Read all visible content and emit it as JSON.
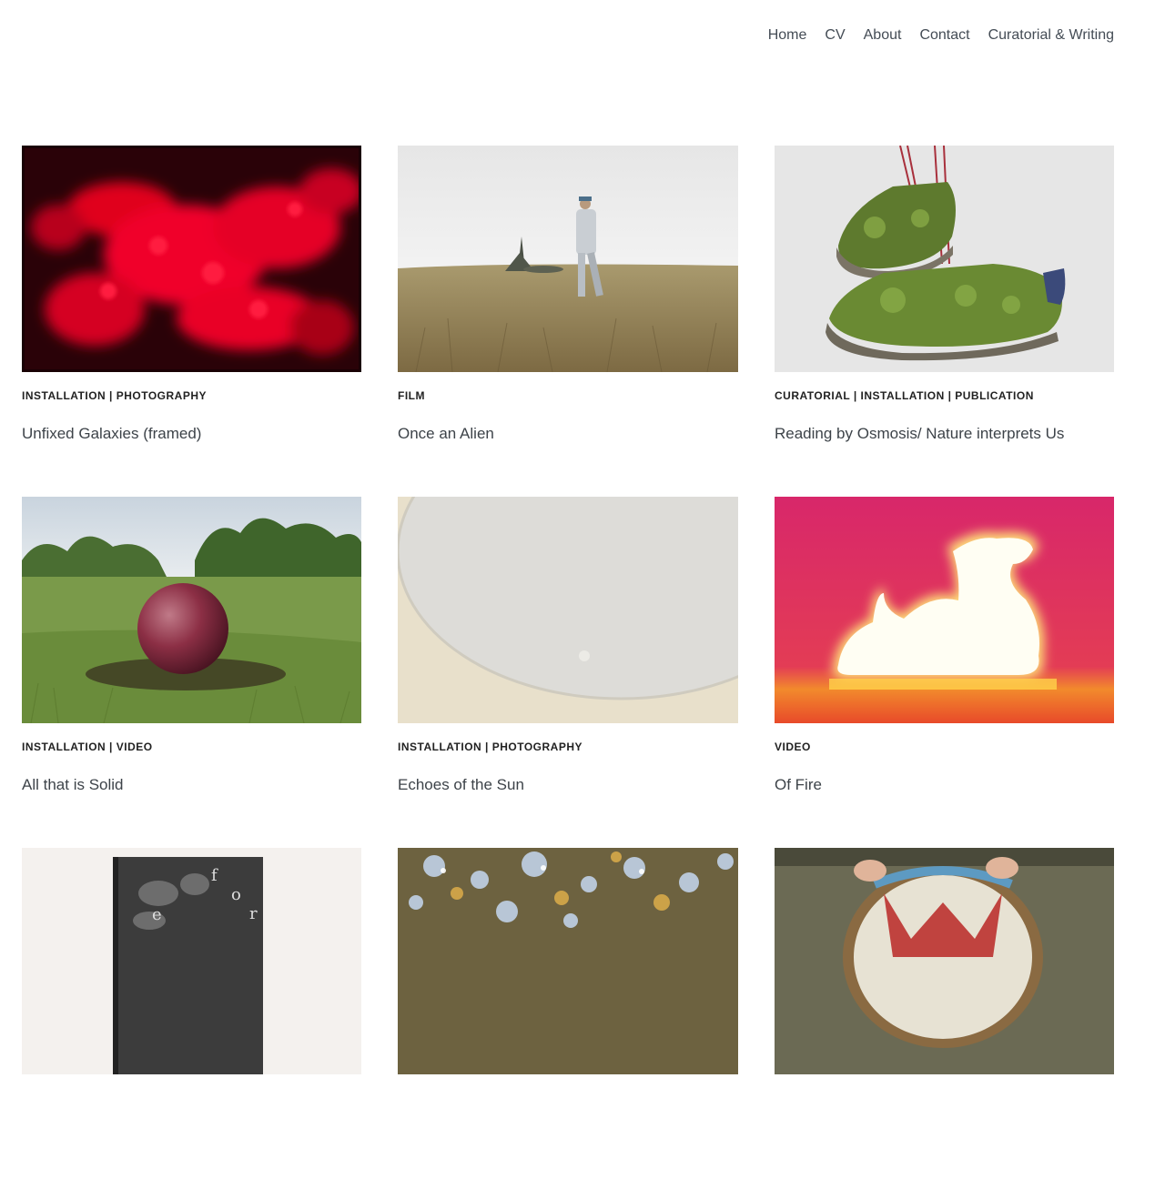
{
  "nav": {
    "items": [
      {
        "label": "Home"
      },
      {
        "label": "CV"
      },
      {
        "label": "About"
      },
      {
        "label": "Contact"
      },
      {
        "label": "Curatorial & Writing"
      }
    ]
  },
  "projects": [
    {
      "categories": "INSTALLATION | PHOTOGRAPHY",
      "title": "Unfixed Galaxies (framed)"
    },
    {
      "categories": "FILM",
      "title": "Once an Alien"
    },
    {
      "categories": "CURATORIAL | INSTALLATION | PUBLICATION",
      "title": "Reading by Osmosis/ Nature interprets Us"
    },
    {
      "categories": "INSTALLATION | VIDEO",
      "title": "All that is Solid"
    },
    {
      "categories": "INSTALLATION | PHOTOGRAPHY",
      "title": "Echoes of the Sun"
    },
    {
      "categories": "VIDEO",
      "title": "Of Fire"
    },
    {
      "categories": "",
      "title": ""
    },
    {
      "categories": "",
      "title": ""
    },
    {
      "categories": "",
      "title": ""
    }
  ],
  "image7_text": {
    "f": "f",
    "o": "o",
    "r": "r",
    "e": "e"
  }
}
